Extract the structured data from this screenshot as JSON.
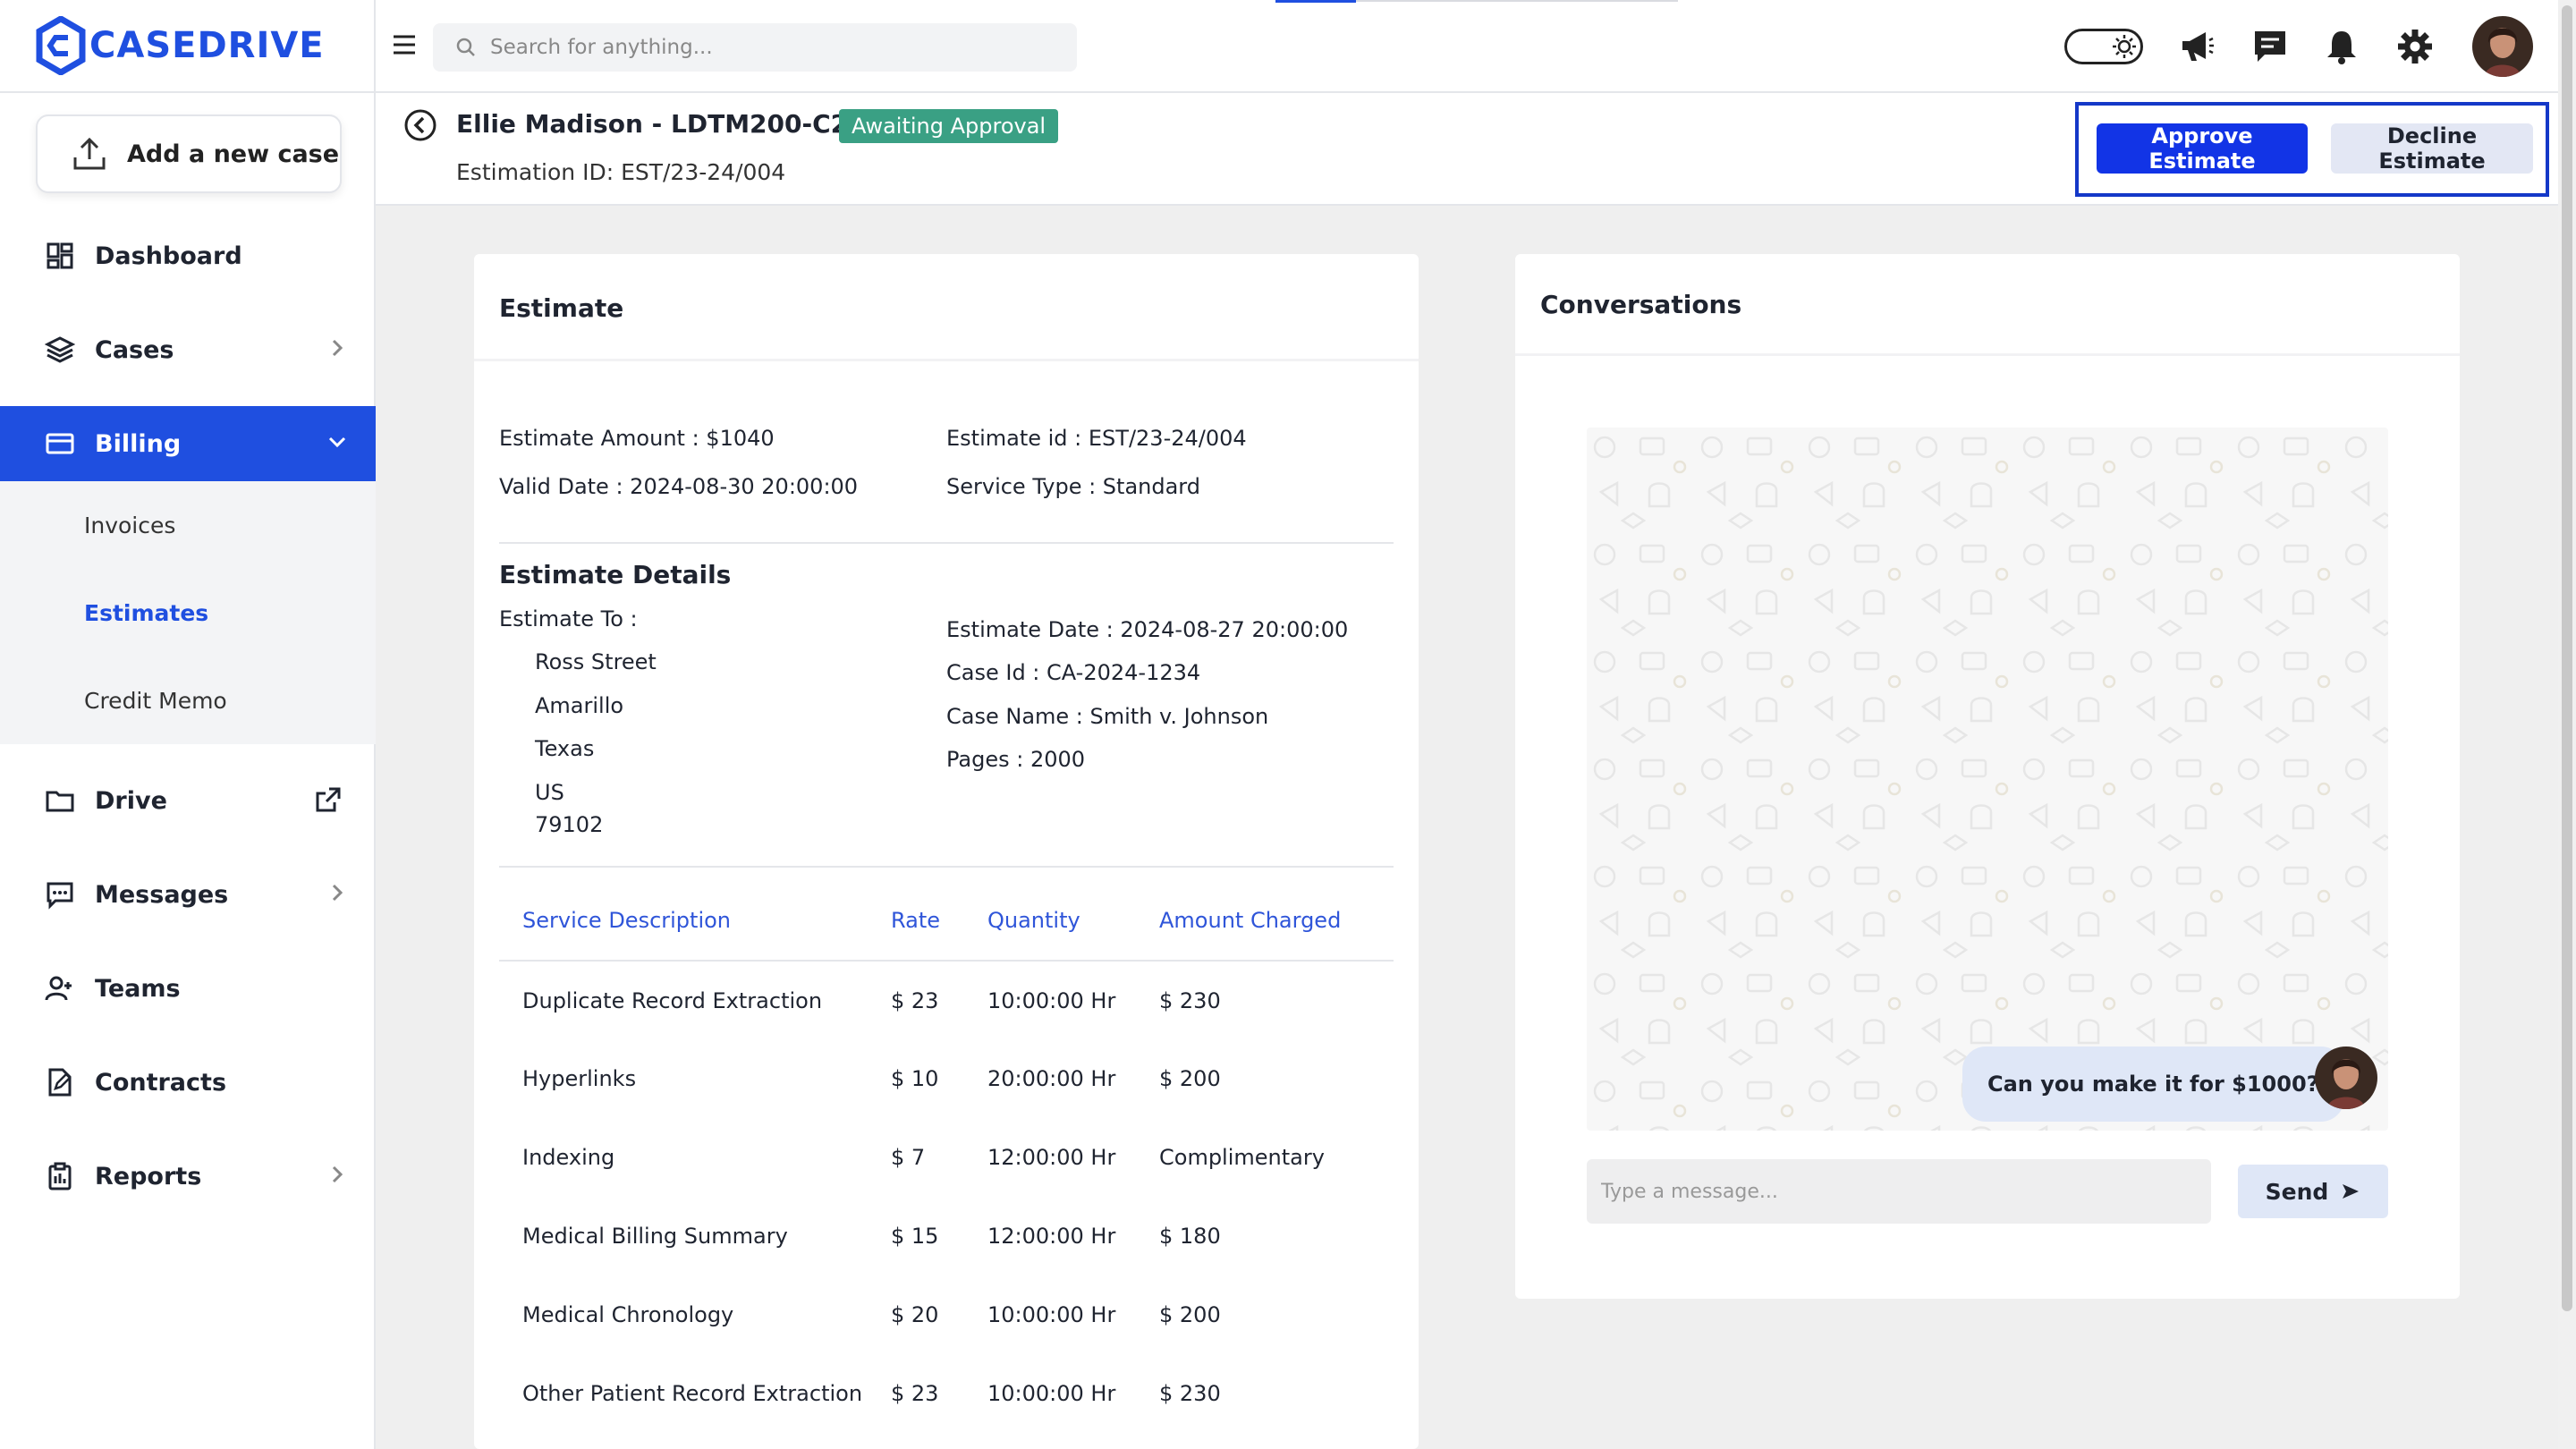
{
  "brand": {
    "logo_text": "CASEDRIVE"
  },
  "sidebar": {
    "add_case_label": "Add a new case",
    "items": [
      {
        "label": "Dashboard"
      },
      {
        "label": "Cases"
      },
      {
        "label": "Billing"
      },
      {
        "label": "Drive"
      },
      {
        "label": "Messages"
      },
      {
        "label": "Teams"
      },
      {
        "label": "Contracts"
      },
      {
        "label": "Reports"
      }
    ],
    "billing_sub": [
      {
        "label": "Invoices"
      },
      {
        "label": "Estimates"
      },
      {
        "label": "Credit Memo"
      }
    ]
  },
  "topbar": {
    "search_placeholder": "Search for anything..."
  },
  "header": {
    "title": "Ellie Madison - LDTM200-C201",
    "status_badge": "Awaiting Approval",
    "estimation_id": "Estimation ID: EST/23-24/004",
    "approve_label": "Approve Estimate",
    "decline_label": "Decline Estimate"
  },
  "estimate": {
    "card_title": "Estimate",
    "amount": "Estimate Amount : $1040",
    "estimate_id": "Estimate id : EST/23-24/004",
    "valid_date": "Valid Date : 2024-08-30 20:00:00",
    "service_type": "Service Type : Standard",
    "details_title": "Estimate Details",
    "estimate_to_label": "Estimate To :",
    "address": [
      "Ross Street",
      "Amarillo",
      "Texas",
      "US",
      "79102"
    ],
    "estimate_date": "Estimate Date : 2024-08-27 20:00:00",
    "case_id": "Case Id : CA-2024-1234",
    "case_name": "Case Name : Smith v. Johnson",
    "pages": "Pages : 2000",
    "table": {
      "headers": [
        "Service Description",
        "Rate",
        "Quantity",
        "Amount Charged"
      ],
      "rows": [
        [
          "Duplicate Record Extraction",
          "$ 23",
          "10:00:00 Hr",
          "$ 230"
        ],
        [
          "Hyperlinks",
          "$ 10",
          "20:00:00 Hr",
          "$ 200"
        ],
        [
          "Indexing",
          "$ 7",
          "12:00:00 Hr",
          "Complimentary"
        ],
        [
          "Medical Billing Summary",
          "$ 15",
          "12:00:00 Hr",
          "$ 180"
        ],
        [
          "Medical Chronology",
          "$ 20",
          "10:00:00 Hr",
          "$ 200"
        ],
        [
          "Other Patient Record Extraction",
          "$ 23",
          "10:00:00 Hr",
          "$ 230"
        ]
      ]
    }
  },
  "conversations": {
    "title": "Conversations",
    "message": "Can you make it for $1000?",
    "input_placeholder": "Type a message...",
    "send_label": "Send"
  },
  "colors": {
    "brand_blue": "#1f4fe0",
    "approve_blue": "#1234e6",
    "badge_green": "#3aa084",
    "table_header_blue": "#2f55d9"
  }
}
